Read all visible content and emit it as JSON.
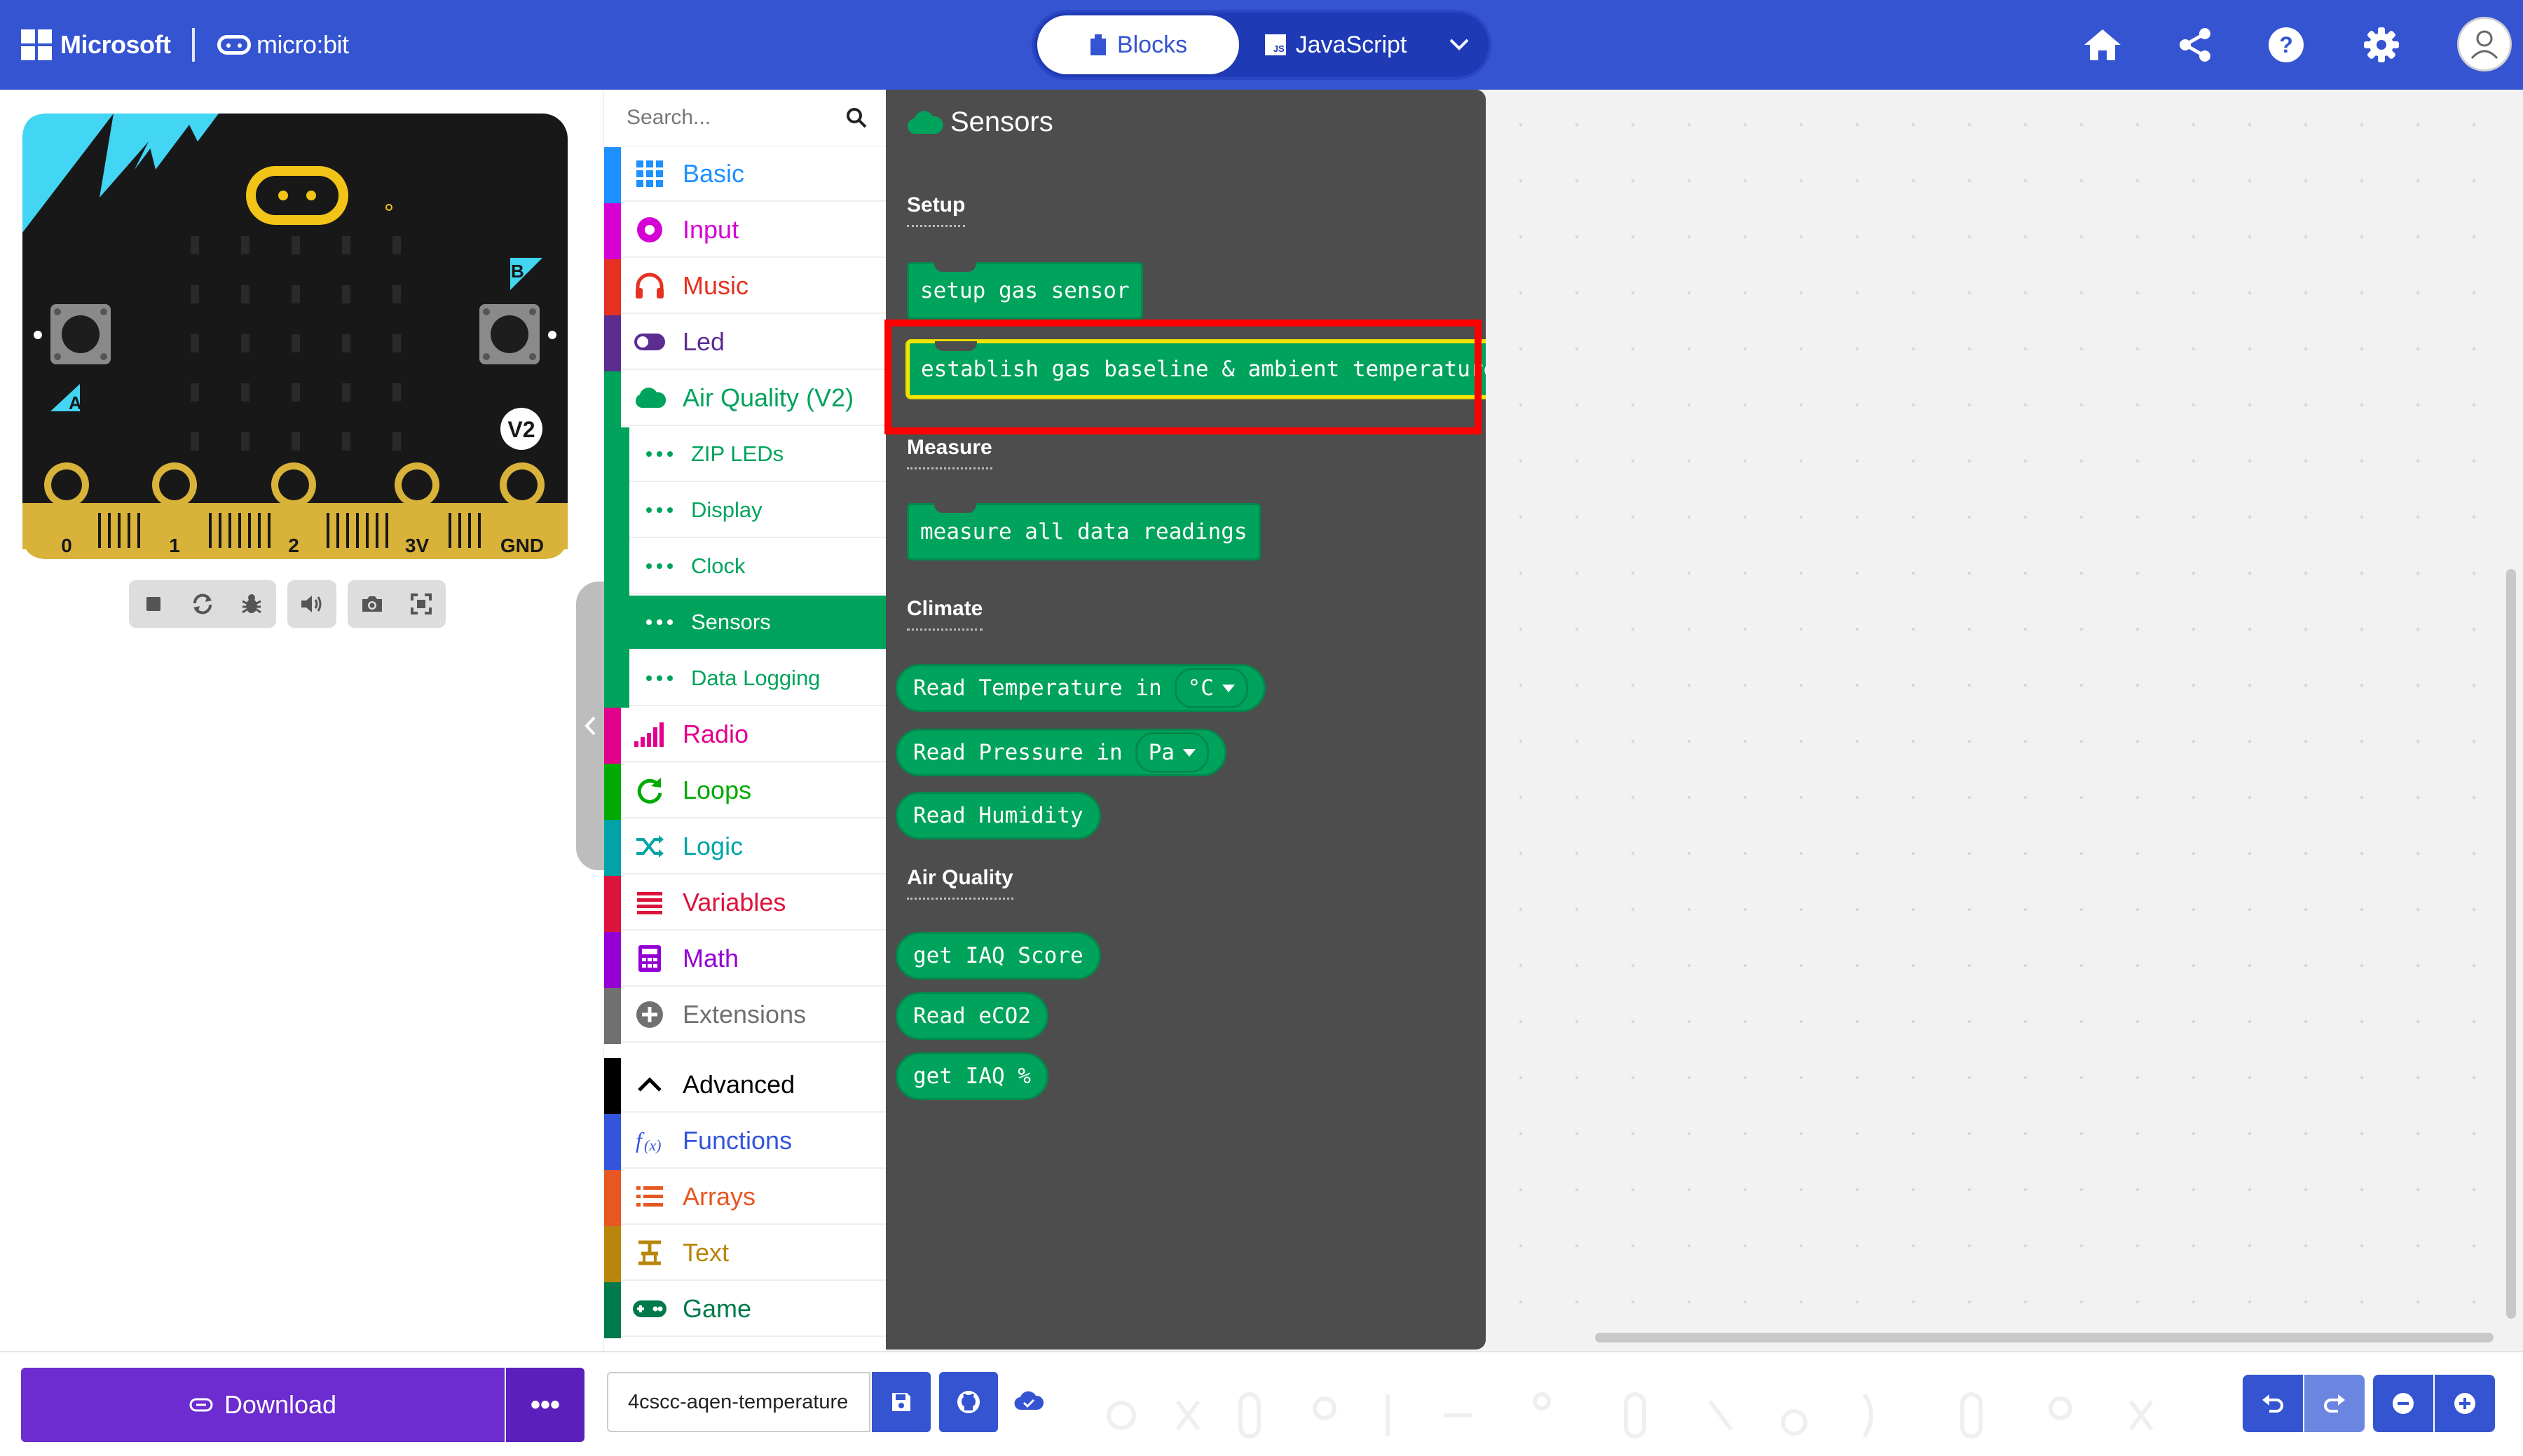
{
  "header": {
    "microsoft_label": "Microsoft",
    "microbit_label": "micro:bit",
    "blocks_label": "Blocks",
    "javascript_label": "JavaScript",
    "js_badge": "JS"
  },
  "simulator": {
    "pin_labels": [
      "0",
      "1",
      "2",
      "3V",
      "GND"
    ],
    "button_a": "A",
    "button_b": "B",
    "version_badge": "V2"
  },
  "toolbox": {
    "search_placeholder": "Search...",
    "categories": [
      {
        "label": "Basic",
        "color": "#1e90ff"
      },
      {
        "label": "Input",
        "color": "#d400d4"
      },
      {
        "label": "Music",
        "color": "#e63022"
      },
      {
        "label": "Led",
        "color": "#5c2d91"
      },
      {
        "label": "Air Quality (V2)",
        "color": "#00a35c"
      },
      {
        "label": "Radio",
        "color": "#e3008c"
      },
      {
        "label": "Loops",
        "color": "#00aa00"
      },
      {
        "label": "Logic",
        "color": "#00a4a6"
      },
      {
        "label": "Variables",
        "color": "#dc143c"
      },
      {
        "label": "Math",
        "color": "#9400d3"
      },
      {
        "label": "Extensions",
        "color": "#707070"
      },
      {
        "label": "Advanced",
        "color": "#000000"
      },
      {
        "label": "Functions",
        "color": "#3455db"
      },
      {
        "label": "Arrays",
        "color": "#e65722"
      },
      {
        "label": "Text",
        "color": "#b8860b"
      },
      {
        "label": "Game",
        "color": "#007a4b"
      }
    ],
    "subcategories": [
      {
        "label": "ZIP LEDs"
      },
      {
        "label": "Display"
      },
      {
        "label": "Clock"
      },
      {
        "label": "Sensors",
        "selected": true
      },
      {
        "label": "Data Logging"
      }
    ]
  },
  "flyout": {
    "title": "Sensors",
    "sections": {
      "setup": "Setup",
      "measure": "Measure",
      "climate": "Climate",
      "air_quality": "Air Quality"
    },
    "blocks": {
      "setup_gas_sensor": "setup gas sensor",
      "establish_baseline": "establish gas baseline & ambient temperature",
      "measure_all": "measure all data readings",
      "read_temperature": "Read Temperature in",
      "temperature_unit": "°C",
      "read_pressure": "Read Pressure in",
      "pressure_unit": "Pa",
      "read_humidity": "Read Humidity",
      "get_iaq_score": "get IAQ Score",
      "read_eco2": "Read eCO2",
      "get_iaq_percent": "get IAQ %"
    }
  },
  "bottom": {
    "download_label": "Download",
    "more_label": "•••",
    "project_name": "4cscc-aqen-temperature"
  },
  "colors": {
    "header_blue": "#3454d1",
    "sensors_green": "#00a35c",
    "flyout_bg": "#4d4d4d",
    "download_purple": "#6c2ccf",
    "highlight_red": "#ff0000"
  }
}
